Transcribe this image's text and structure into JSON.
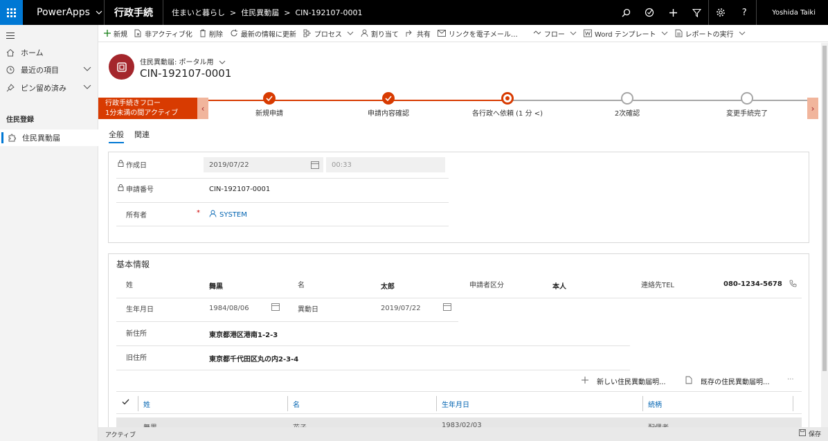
{
  "topbar": {
    "brand": "PowerApps",
    "app_title": "行政手続",
    "breadcrumb": [
      "住まいと暮らし",
      "住民異動届",
      "CIN-192107-0001"
    ],
    "user_name": "Yoshida Taiki"
  },
  "sidebar": {
    "items": [
      {
        "label": "ホーム",
        "icon": "home-icon"
      },
      {
        "label": "最近の項目",
        "icon": "clock-icon"
      },
      {
        "label": "ピン留め済み",
        "icon": "pin-icon"
      }
    ],
    "section_title": "住民登録",
    "entity_item": "住民異動届"
  },
  "commands": [
    "新規",
    "非アクティブ化",
    "削除",
    "最新の情報に更新",
    "プロセス",
    "割り当て",
    "共有",
    "リンクを電子メール…",
    "フロー",
    "Word テンプレート",
    "レポートの実行"
  ],
  "record": {
    "entity_label": "住民異動届: ポータル用",
    "title": "CIN-192107-0001"
  },
  "bpf": {
    "flag_title": "行政手続きフロー",
    "flag_subtitle": "1分未満の間アクティブ",
    "stages": [
      {
        "label": "新規申請",
        "status": "done"
      },
      {
        "label": "申請内容確認",
        "status": "done"
      },
      {
        "label": "各行政へ依頼  (1 分 <)",
        "status": "active"
      },
      {
        "label": "2次確認",
        "status": "todo"
      },
      {
        "label": "変更手続完了",
        "status": "todo"
      }
    ]
  },
  "tabs": [
    "全般",
    "関連"
  ],
  "general": {
    "created_label": "作成日",
    "created_date": "2019/07/22",
    "created_time": "00:33",
    "appno_label": "申請番号",
    "appno_value": "CIN-192107-0001",
    "owner_label": "所有者",
    "owner_required": "*",
    "owner_value": "SYSTEM"
  },
  "basic": {
    "title": "基本情報",
    "sei_label": "姓",
    "sei_value": "舞黒",
    "mei_label": "名",
    "mei_value": "太郎",
    "kubun_label": "申請者区分",
    "kubun_value": "本人",
    "tel_label": "連絡先TEL",
    "tel_value": "080-1234-5678",
    "birth_label": "生年月日",
    "birth_value": "1984/08/06",
    "move_label": "異動日",
    "move_value": "2019/07/22",
    "newaddr_label": "新住所",
    "newaddr_value": "東京都港区港南1-2-3",
    "oldaddr_label": "旧住所",
    "oldaddr_value": "東京都千代田区丸の内2-3-4"
  },
  "subgrid": {
    "new_button": "新しい住民異動届明...",
    "existing_button": "既存の住民異動届明...",
    "more": "···",
    "columns": [
      "姓",
      "名",
      "生年月日",
      "続柄"
    ],
    "row": [
      "舞黒",
      "花子",
      "1983/02/03",
      "配偶者"
    ]
  },
  "status": {
    "state": "アクティブ",
    "save": "保存"
  }
}
